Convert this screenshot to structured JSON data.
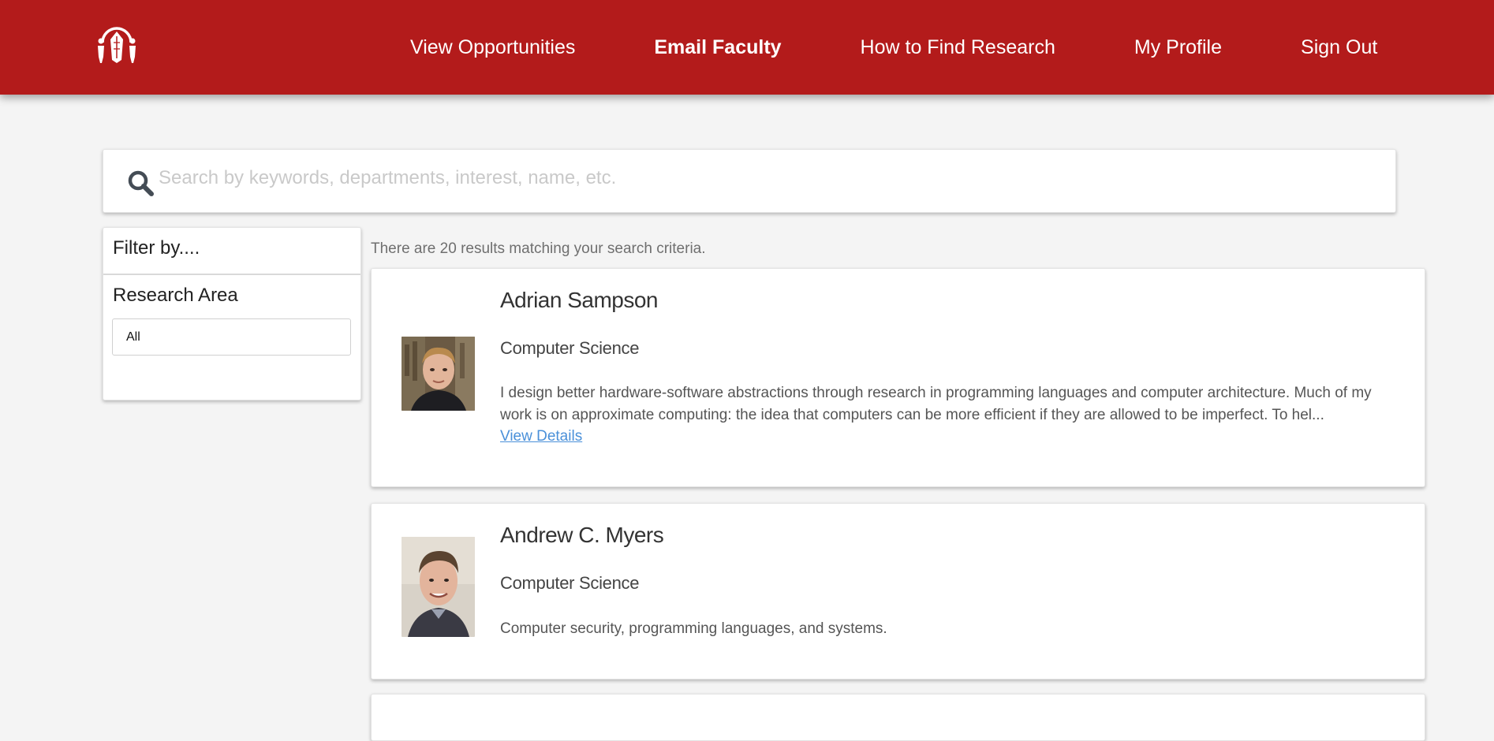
{
  "nav": {
    "logo_icon": "bear-seal-logo-icon",
    "links": [
      {
        "label": "View Opportunities",
        "active": false
      },
      {
        "label": "Email Faculty",
        "active": true
      },
      {
        "label": "How to Find Research",
        "active": false
      },
      {
        "label": "My Profile",
        "active": false
      },
      {
        "label": "Sign Out",
        "active": false
      }
    ]
  },
  "search": {
    "icon": "search-icon",
    "placeholder": "Search by keywords, departments, interest, name, etc.",
    "value": ""
  },
  "filter": {
    "header": "Filter by....",
    "research_area_label": "Research Area",
    "research_area_value": "All"
  },
  "results": {
    "count_text": "There are 20 results matching your search criteria.",
    "items": [
      {
        "name": "Adrian Sampson",
        "department": "Computer Science",
        "description": "I design better hardware-software abstractions through research in programming languages and computer architecture. Much of my work is on approximate computing: the idea that computers can be more efficient if they are allowed to be imperfect. To hel...",
        "link": "View Details"
      },
      {
        "name": "Andrew C. Myers",
        "department": "Computer Science",
        "description": "Computer security, programming languages, and systems."
      }
    ]
  },
  "colors": {
    "brand": "#b31b1b",
    "background": "#f4f4f4",
    "link": "#4a90d9"
  }
}
